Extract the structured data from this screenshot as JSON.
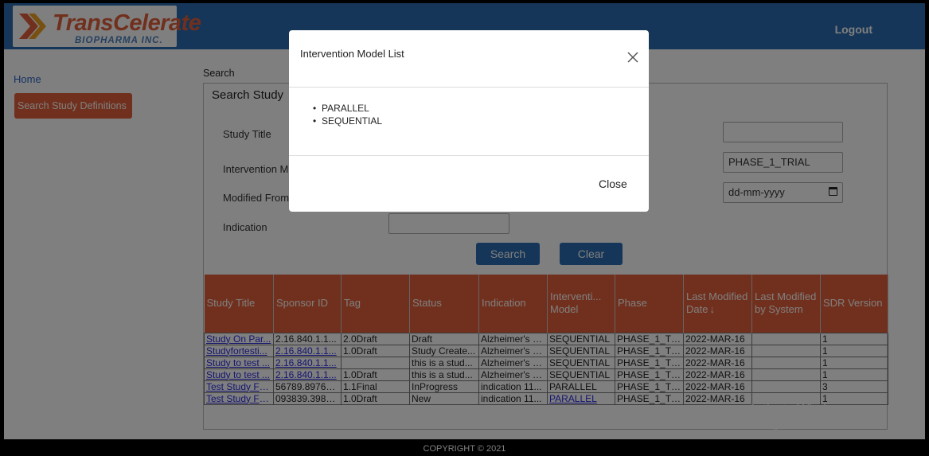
{
  "header": {
    "brand": "TransCelerate",
    "brand_sub": "BIOPHARMA INC.",
    "logout": "Logout"
  },
  "sidebar": {
    "home": "Home",
    "search_defs": "Search Study Definitions"
  },
  "main": {
    "breadcrumb": "Search",
    "panel_title": "Search Study",
    "labels": {
      "study_title": "Study Title",
      "intervention": "Intervention M",
      "modified_from": "Modified From",
      "indication": "Indication"
    },
    "phase_value": "PHASE_1_TRIAL",
    "date_placeholder": "dd-mm-yyyy",
    "search_button": "Search",
    "clear_button": "Clear"
  },
  "table": {
    "headers": [
      "Study Title",
      "Sponsor ID",
      "Tag",
      "Status",
      "Indication",
      "Interventi... Model",
      "Phase",
      "Last Modified Date",
      "Last Modified by System",
      "SDR Version"
    ],
    "rows": [
      [
        "Study On Par...",
        "2.16.840.1.1...",
        "2.0Draft",
        "Draft",
        "Alzheimer's d...",
        "SEQUENTIAL",
        "PHASE_1_TR...",
        "2022-MAR-16",
        "",
        "1"
      ],
      [
        "Studyfortesti...",
        "2.16.840.1.1...",
        "1.0Draft",
        "Study Create...",
        "Alzheimer's d...",
        "SEQUENTIAL",
        "PHASE_1_TR...",
        "2022-MAR-16",
        "",
        "1"
      ],
      [
        "Study to test ...",
        "2.16.840.1.1...",
        "",
        "this is a stud...",
        "Alzheimer's d...",
        "SEQUENTIAL",
        "PHASE_1_TR...",
        "2022-MAR-16",
        "",
        "1"
      ],
      [
        "Study to test ...",
        "2.16.840.1.1...",
        "1.0Draft",
        "this is a stud...",
        "Alzheimer's d...",
        "SEQUENTIAL",
        "PHASE_1_TR...",
        "2022-MAR-16",
        "",
        "1"
      ],
      [
        "Test Study Fo...",
        "56789.89765...",
        "1.1Final",
        "InProgress",
        "indication 11...",
        "PARALLEL",
        "PHASE_1_TR...",
        "2022-MAR-16",
        "",
        "3"
      ],
      [
        "Test Study Fo...",
        "093839.3983...",
        "1.0Draft",
        "New",
        "indication 11...",
        "PARALLEL",
        "PHASE_1_TR...",
        "2022-MAR-16",
        "",
        "1"
      ]
    ]
  },
  "footer": "COPYRIGHT © 2021",
  "watermark": {
    "line1": "Activate Windows",
    "line2": "Go to Settings to activate Windows."
  },
  "modal": {
    "title": "Intervention Model List",
    "items": [
      "PARALLEL",
      "SEQUENTIAL"
    ],
    "close": "Close"
  },
  "colors": {
    "header_blue": "#2b6cb0",
    "accent_orange": "#e2603a"
  },
  "icons": [
    "transcelerate-logo",
    "calendar-icon",
    "sort-down-icon",
    "close-icon"
  ]
}
